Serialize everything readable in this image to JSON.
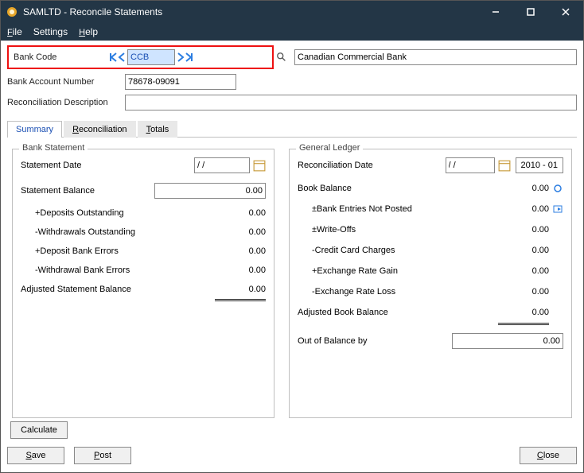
{
  "window": {
    "title": "SAMLTD - Reconcile Statements"
  },
  "menu": {
    "file": "File",
    "settings": "Settings",
    "help": "Help"
  },
  "header": {
    "bank_code_label": "Bank Code",
    "bank_code_value": "CCB",
    "bank_name_value": "Canadian Commercial Bank",
    "account_label": "Bank Account Number",
    "account_value": "78678-09091",
    "desc_label": "Reconciliation Description",
    "desc_value": ""
  },
  "tabs": {
    "summary": "Summary",
    "reconciliation": "Reconciliation",
    "totals": "Totals"
  },
  "left": {
    "group_title": "Bank Statement",
    "stmt_date_label": "Statement Date",
    "stmt_date_value": "/ /",
    "stmt_bal_label": "Statement Balance",
    "stmt_bal_value": "0.00",
    "dep_out_label": "+Deposits Outstanding",
    "dep_out_value": "0.00",
    "wd_out_label": "-Withdrawals Outstanding",
    "wd_out_value": "0.00",
    "dep_err_label": "+Deposit Bank Errors",
    "dep_err_value": "0.00",
    "wd_err_label": "-Withdrawal Bank Errors",
    "wd_err_value": "0.00",
    "adj_label": "Adjusted Statement Balance",
    "adj_value": "0.00"
  },
  "right": {
    "group_title": "General Ledger",
    "rec_date_label": "Reconciliation Date",
    "rec_date_value": "/ /",
    "year_period": "2010 - 01",
    "book_bal_label": "Book Balance",
    "book_bal_value": "0.00",
    "not_posted_label": "±Bank Entries Not Posted",
    "not_posted_value": "0.00",
    "writeoff_label": "±Write-Offs",
    "writeoff_value": "0.00",
    "cc_label": "-Credit Card Charges",
    "cc_value": "0.00",
    "gain_label": "+Exchange Rate Gain",
    "gain_value": "0.00",
    "loss_label": "-Exchange Rate Loss",
    "loss_value": "0.00",
    "adj_label": "Adjusted Book Balance",
    "adj_value": "0.00",
    "out_label": "Out of Balance by",
    "out_value": "0.00"
  },
  "buttons": {
    "calculate": "Calculate",
    "save": "Save",
    "post": "Post",
    "close": "Close"
  }
}
